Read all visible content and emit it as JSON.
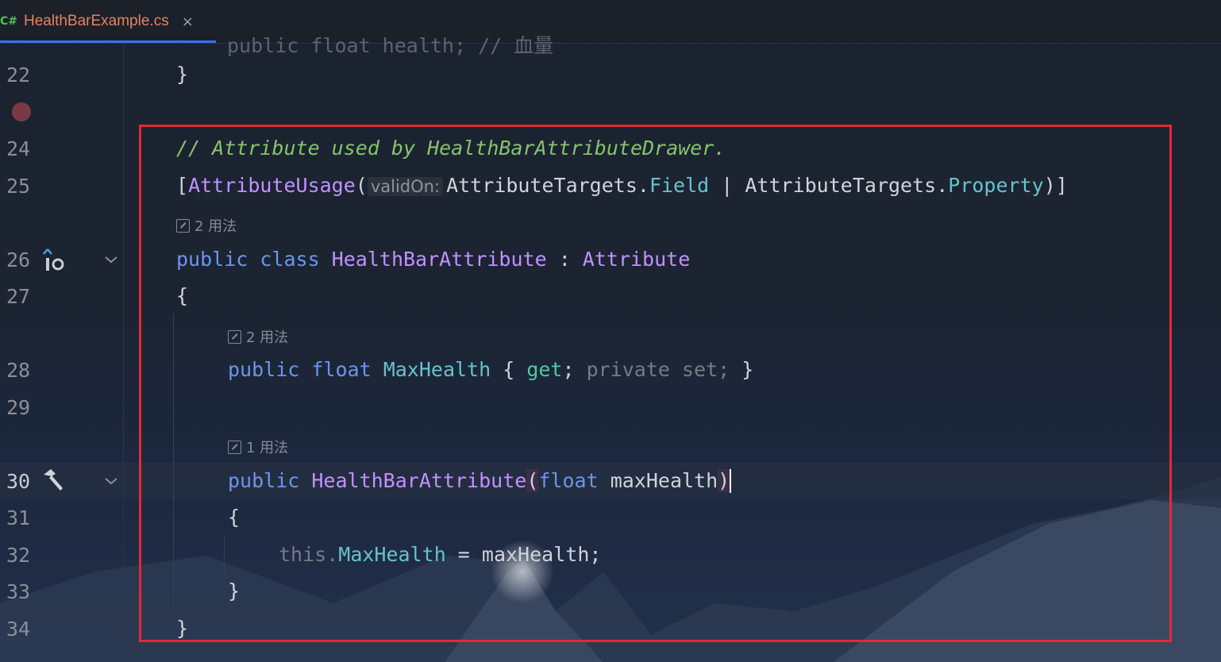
{
  "tab": {
    "icon": "C#",
    "filename": "HealthBarExample.cs",
    "close": "×"
  },
  "gutter": {
    "line_numbers": [
      "22",
      "24",
      "25",
      "26",
      "27",
      "28",
      "29",
      "30",
      "31",
      "32",
      "33",
      "34"
    ],
    "icons": [
      "breakpoint-icon",
      "implements-icon",
      "hammer-icon",
      "fold-chevron-icon"
    ]
  },
  "code": {
    "top_fragment": "public float health; // 血量",
    "line22": "}",
    "line24_comment": "// Attribute used by HealthBarAttributeDrawer.",
    "line25": {
      "open_bracket": "[",
      "attr": "AttributeUsage",
      "open_paren": "(",
      "param_hint": "validOn:",
      "type1": "AttributeTargets",
      "dot1": ".",
      "member1": "Field",
      "pipe": " | ",
      "type2": "AttributeTargets",
      "dot2": ".",
      "member2": "Property",
      "close": ")]"
    },
    "usage_hint_class": "2 用法",
    "line26": {
      "kw1": "public",
      "kw2": "class",
      "name": "HealthBarAttribute",
      "colon": " : ",
      "base": "Attribute"
    },
    "line27": "{",
    "usage_hint_prop": "2 用法",
    "line28": {
      "kw1": "public",
      "kw2": "float",
      "name": "MaxHealth",
      "open": " { ",
      "get": "get",
      "semi": "; ",
      "private_set": "private set;",
      "close": " }"
    },
    "usage_hint_ctor": "1 用法",
    "line30": {
      "kw1": "public",
      "name": "HealthBarAttribute",
      "open": "(",
      "type": "float",
      "param": " maxHealth",
      "close": ")"
    },
    "line31": "{",
    "line32": {
      "this": "this",
      "dot": ".",
      "prop": "MaxHealth",
      "rest": " = maxHealth;"
    },
    "line33": "}",
    "line34": "}"
  },
  "colors": {
    "keyword": "#6c95eb",
    "class": "#c191ff",
    "property": "#66c3cc",
    "comment": "#85c46c",
    "highlight_box": "#e02a35"
  }
}
